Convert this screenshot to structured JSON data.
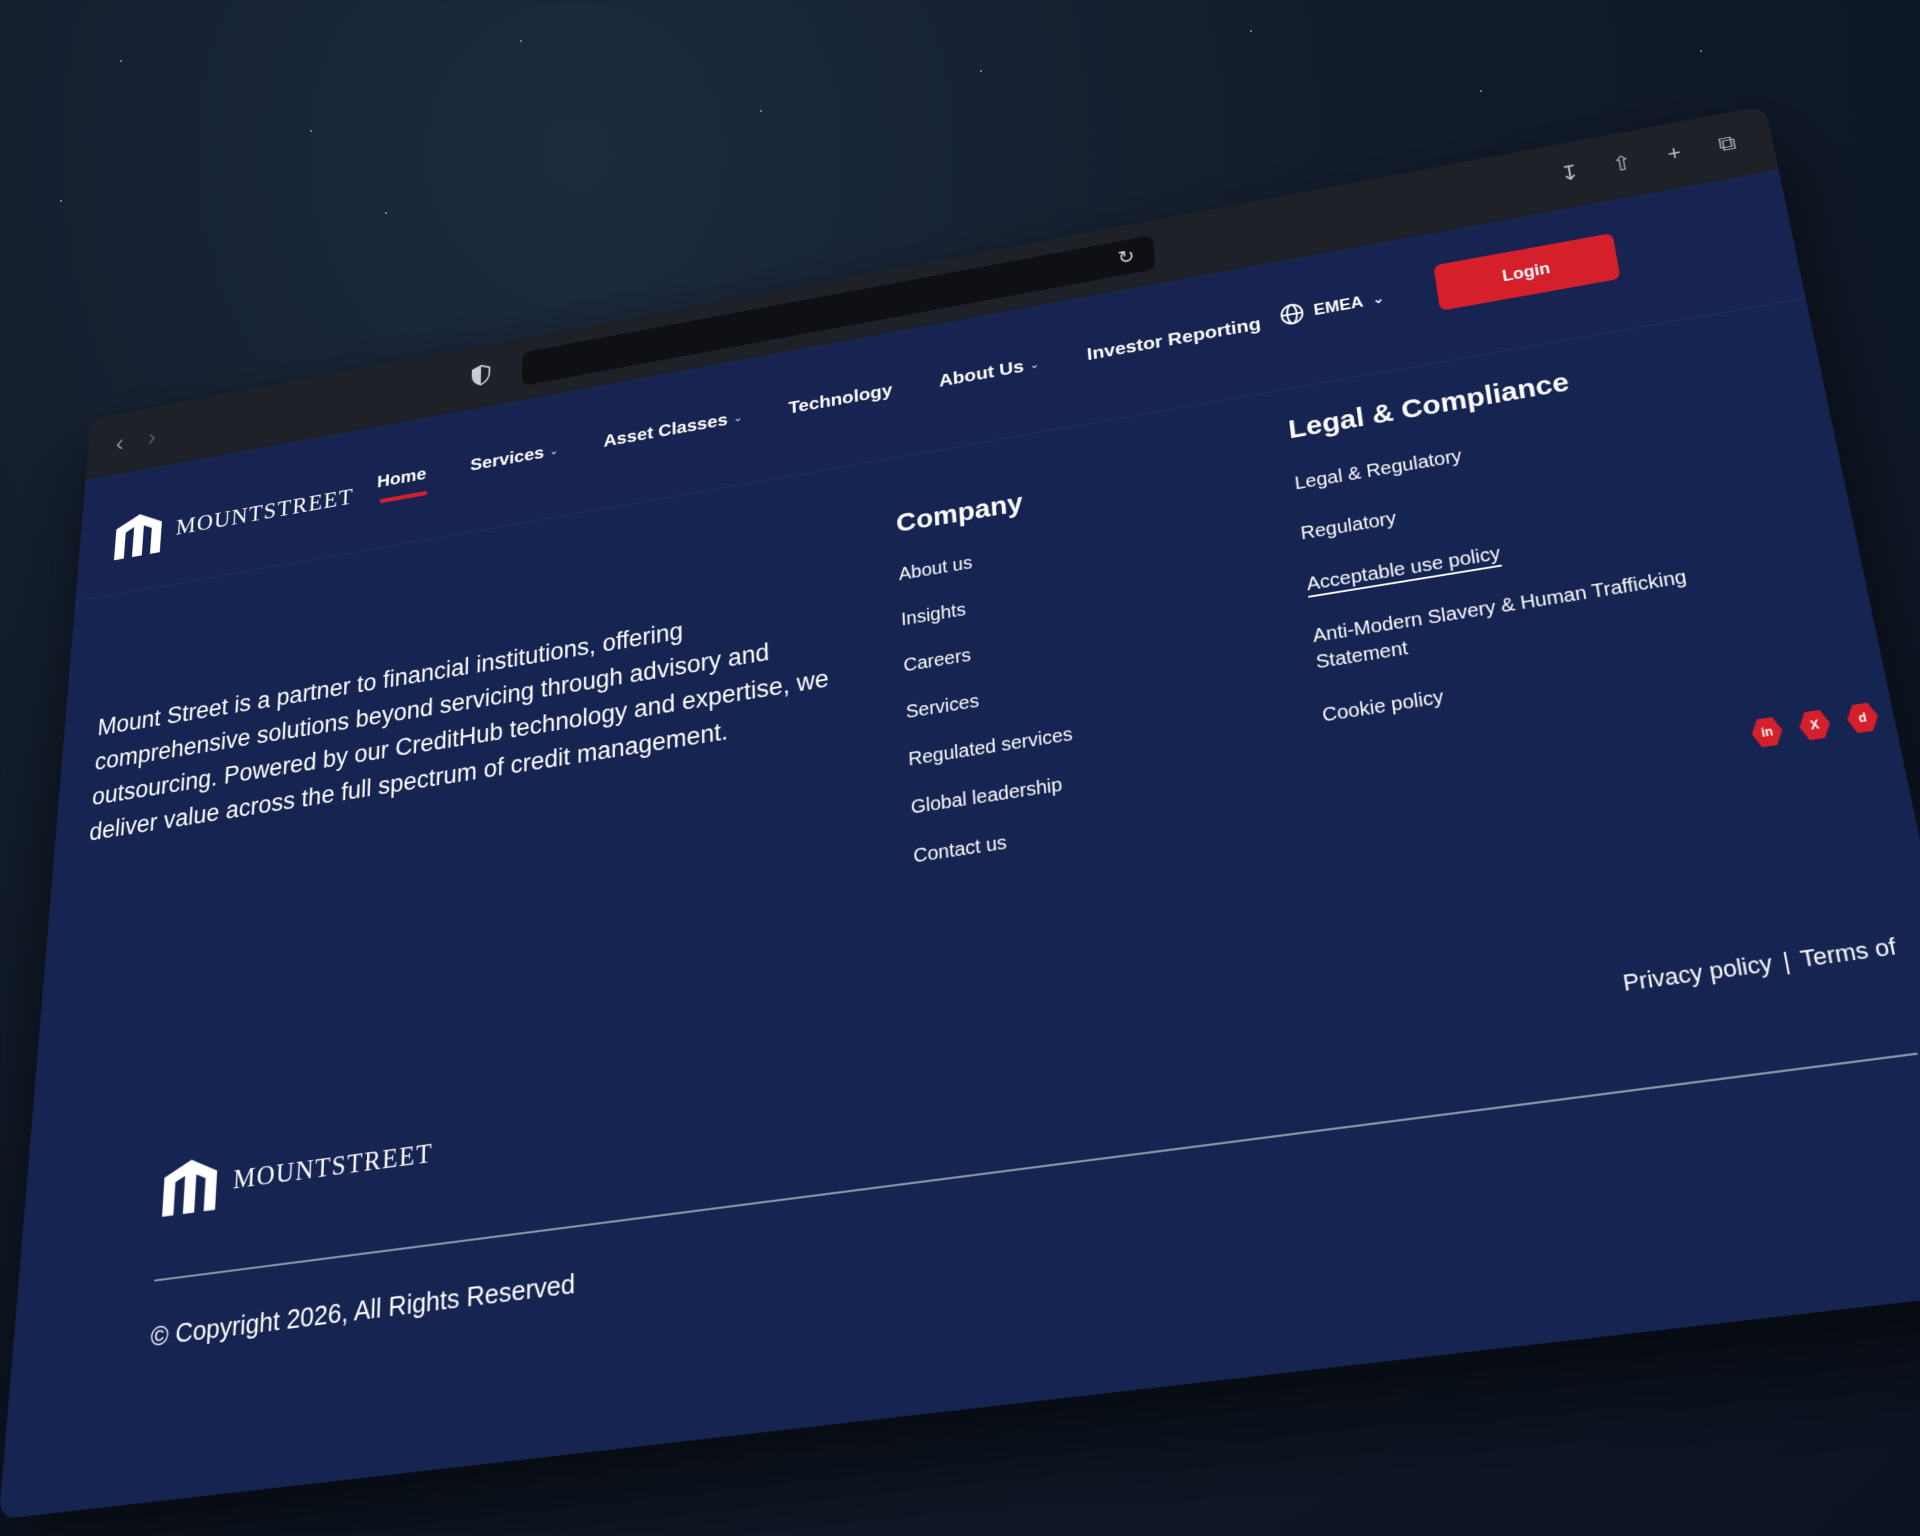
{
  "browser": {
    "back_icon": "chevron-left-icon",
    "forward_icon": "chevron-right-icon",
    "shield_icon": "shield-icon",
    "reload_icon": "reload-icon",
    "toolbar_icons": [
      "download-icon",
      "share-icon",
      "new-tab-icon",
      "tabs-overview-icon"
    ]
  },
  "header": {
    "logo_text": "MOUNTSTREET",
    "menu": [
      {
        "label": "Home",
        "active": true,
        "dropdown": false
      },
      {
        "label": "Services",
        "dropdown": true
      },
      {
        "label": "Asset Classes",
        "dropdown": true
      },
      {
        "label": "Technology",
        "dropdown": false
      },
      {
        "label": "About Us",
        "dropdown": true
      },
      {
        "label": "Investor Reporting",
        "dropdown": false
      }
    ],
    "region": "EMEA",
    "login_label": "Login"
  },
  "footer": {
    "tagline": "Mount Street is a partner to financial institutions, offering comprehensive solutions beyond servicing through advisory and outsourcing. Powered by our CreditHub technology and expertise, we deliver value across the full spectrum of credit management.",
    "company": {
      "title": "Company",
      "links": [
        "About us",
        "Insights",
        "Careers",
        "Services",
        "Regulated services",
        "Global leadership",
        "Contact us"
      ]
    },
    "legal": {
      "title": "Legal & Compliance",
      "links": [
        "Legal & Regulatory",
        "Regulatory",
        "Acceptable use policy",
        "Anti-Modern Slavery & Human Trafficking Statement",
        "Cookie policy"
      ]
    },
    "social": [
      {
        "icon": "linkedin-icon",
        "glyph": "in"
      },
      {
        "icon": "x-icon",
        "glyph": "X"
      },
      {
        "icon": "tiktok-icon",
        "glyph": "d"
      }
    ],
    "logo_text": "MOUNTSTREET",
    "bottom_links": [
      "Privacy policy",
      "|",
      "Terms of"
    ],
    "copyright": "© Copyright 2026, All Rights Reserved"
  },
  "colors": {
    "page_bg": "#162452",
    "accent": "#d51f2b",
    "chrome": "#1e2127"
  }
}
